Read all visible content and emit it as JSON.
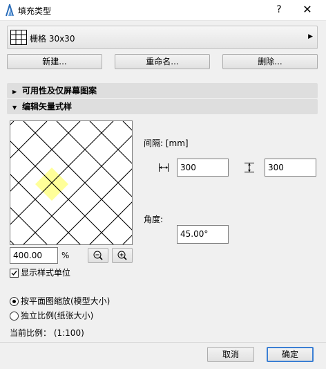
{
  "window": {
    "title": "填充类型",
    "help_label": "?",
    "close_label": "✕",
    "icon": "archicad-icon"
  },
  "fill": {
    "name": "栅格 30x30",
    "icon": "grid-fill-icon"
  },
  "buttons": {
    "new": "新建...",
    "rename": "重命名...",
    "delete": "删除...",
    "cancel": "取消",
    "ok": "确定"
  },
  "sections": {
    "availability": "可用性及仅屏幕图案",
    "edit_vector": "编辑矢量式样"
  },
  "pattern": {
    "spacing_label": "间隔: [mm]",
    "h_spacing": "300",
    "v_spacing": "300",
    "angle_label": "角度:",
    "angle": "45.00°",
    "highlight_color": "#ffff99",
    "line_color": "#000000"
  },
  "zoom": {
    "value": "400.00",
    "unit": "%"
  },
  "options": {
    "show_units_label": "显示样式单位",
    "show_units_checked": true,
    "scale_plan_label": "按平面图缩放(模型大小)",
    "scale_plan_selected": true,
    "scale_paper_label": "独立比例(纸张大小)",
    "scale_paper_selected": false,
    "current_scale": "当前比例： (1:100)"
  }
}
